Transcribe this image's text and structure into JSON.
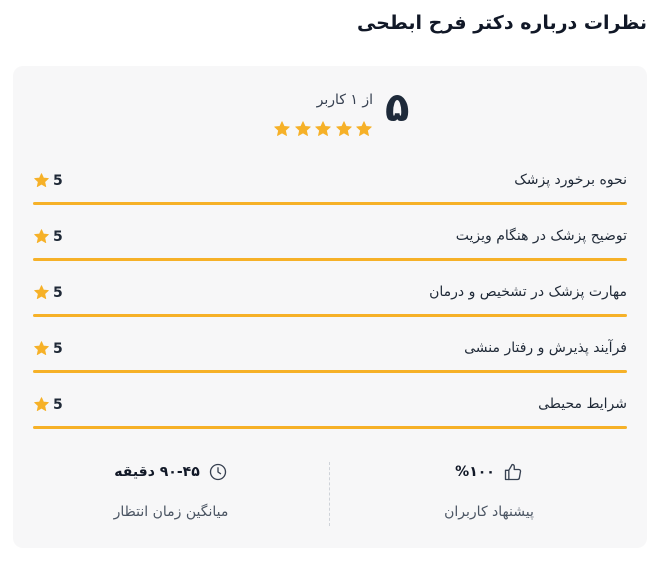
{
  "page": {
    "title": "نظرات درباره دکتر فرح ابطحی"
  },
  "summary": {
    "score": "۵",
    "out_of_text": "از ۱ کاربر",
    "stars_filled": 5,
    "stars_total": 5
  },
  "criteria": [
    {
      "label": "نحوه برخورد پزشک",
      "score": "5",
      "fraction": 1.0
    },
    {
      "label": "توضیح پزشک در هنگام ویزیت",
      "score": "5",
      "fraction": 1.0
    },
    {
      "label": "مهارت پزشک در تشخیص و درمان",
      "score": "5",
      "fraction": 1.0
    },
    {
      "label": "فرآیند پذیرش و رفتار منشی",
      "score": "5",
      "fraction": 1.0
    },
    {
      "label": "شرایط محیطی",
      "score": "5",
      "fraction": 1.0
    }
  ],
  "stats": {
    "recommend_value": "%۱۰۰",
    "recommend_caption": "پیشنهاد کاربران",
    "recommend_icon": "thumbs-up-icon",
    "wait_value": "۹۰-۴۵ دقیقه",
    "wait_caption": "میانگین زمان انتظار",
    "wait_icon": "clock-icon"
  },
  "colors": {
    "star": "#f6b128",
    "bar": "#f6b128",
    "card_bg": "#f7f7f8"
  }
}
